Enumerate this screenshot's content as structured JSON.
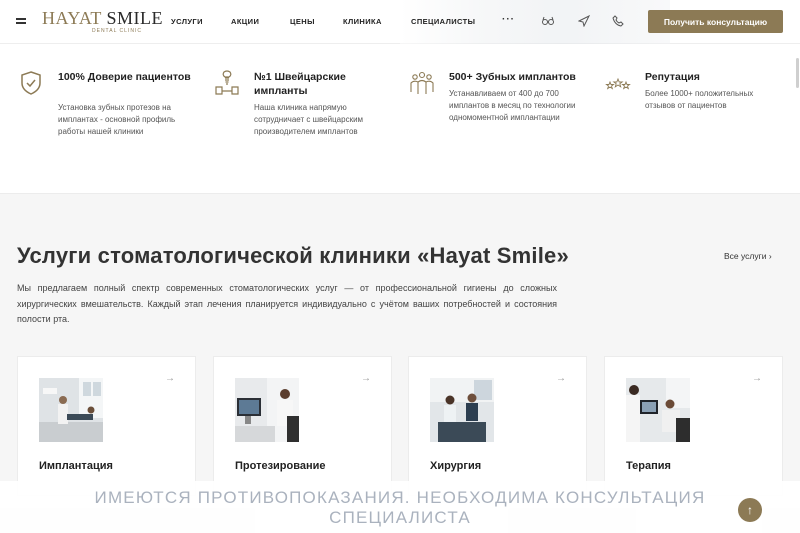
{
  "header": {
    "logo_main": "SMILE",
    "logo_hay": "HAYAT",
    "logo_sub": "DENTAL CLINIC",
    "nav": [
      "Услуги",
      "Акции",
      "Цены",
      "Клиника",
      "Специалисты"
    ],
    "more": "···",
    "cta": "Получить консультацию"
  },
  "features": [
    {
      "icon": "shield-check-icon",
      "title": "100% Доверие пациентов",
      "text": "Установка зубных протезов на имплантах - основной профиль работы нашей клиники"
    },
    {
      "icon": "implant-icon",
      "title": "№1 Швейцарские импланты",
      "text": "Наша клиника напрямую сотрудничает с швейцарским производителем имплантов"
    },
    {
      "icon": "people-icon",
      "title": "500+ Зубных имплантов",
      "text": "Устанавливаем от 400 до 700 имплантов в месяц по технологии одномоментной имплантации"
    },
    {
      "icon": "stars-icon",
      "title": "Репутация",
      "text": "Более 1000+ положительных отзывов от пациентов"
    }
  ],
  "services": {
    "title": "Услуги стоматологической клиники «Hayat Smile»",
    "all_link": "Все услуги",
    "description": "Мы предлагаем полный спектр современных стоматологических услуг — от профессиональной гигиены до сложных хирургических вмешательств. Каждый этап лечения планируется индивидуально с учётом ваших потребностей и состояния полости рта.",
    "cards": [
      {
        "title": "Имплантация",
        "arrow": "→"
      },
      {
        "title": "Протезирование",
        "arrow": "→"
      },
      {
        "title": "Хирургия",
        "arrow": "→"
      },
      {
        "title": "Терапия",
        "arrow": "→"
      }
    ]
  },
  "disclaimer": "Имеются противопоказания. Необходима консультация специалиста",
  "colors": {
    "accent": "#8c7a55",
    "disclaimer": "#aab2be"
  }
}
